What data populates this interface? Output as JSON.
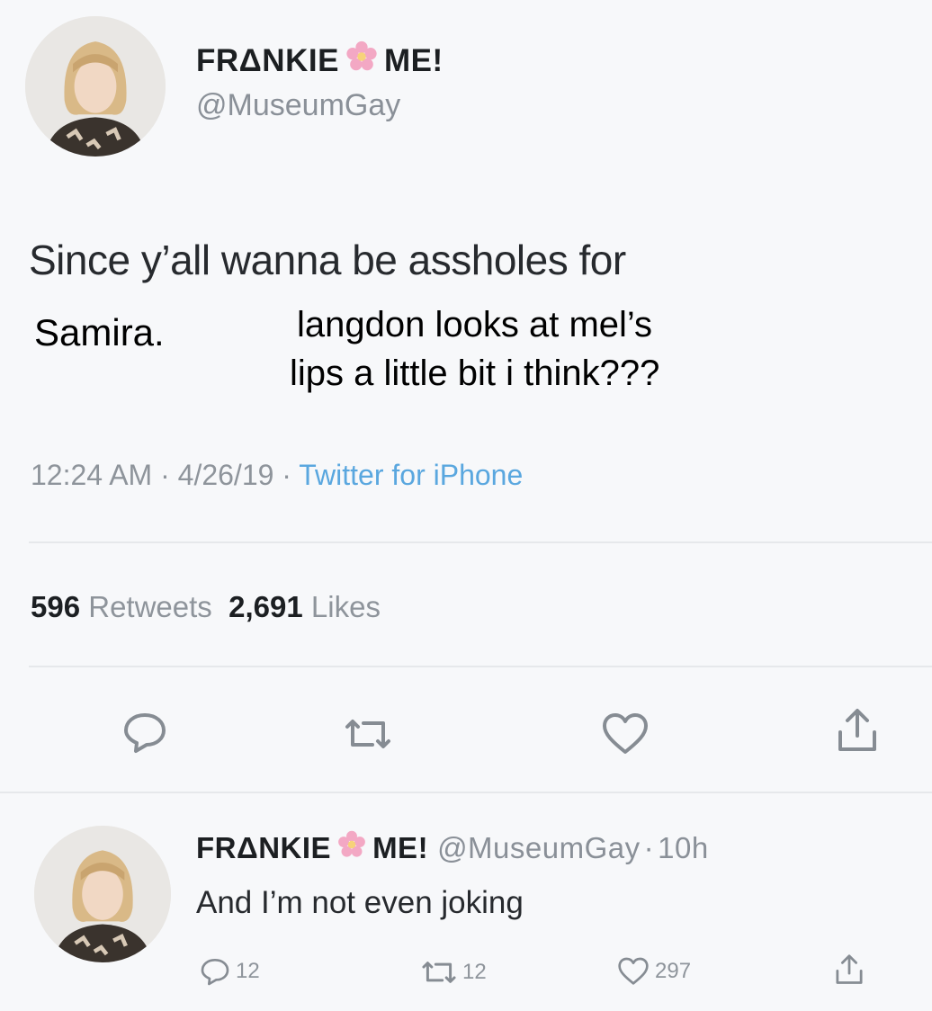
{
  "tweet": {
    "display_name_left": "FRΔNKIE",
    "display_name_right": "ME!",
    "handle": "@MuseumGay",
    "text_line1": "Since y’all wanna be assholes for",
    "text_line2": "Samira.",
    "overlay_line1": "langdon looks at mel’s",
    "overlay_line2": "lips a little bit i think???",
    "time": "12:24 AM",
    "date": "4/26/19",
    "source": "Twitter for iPhone",
    "sep": "·",
    "retweets_count": "596",
    "retweets_label": "Retweets",
    "likes_count": "2,691",
    "likes_label": "Likes"
  },
  "reply": {
    "display_name_left": "FRΔNKIE",
    "display_name_right": "ME!",
    "handle": "@MuseumGay",
    "sep": "·",
    "age": "10h",
    "text": "And I’m not even joking",
    "reply_count": "12",
    "retweet_count": "12",
    "like_count": "297"
  },
  "colors": {
    "background": "#f7f8fa",
    "link": "#5aa7df",
    "muted": "#8e949b",
    "flower": "#f3a8c4"
  },
  "icons": [
    "reply-icon",
    "retweet-icon",
    "like-icon",
    "share-icon",
    "flower-icon"
  ]
}
